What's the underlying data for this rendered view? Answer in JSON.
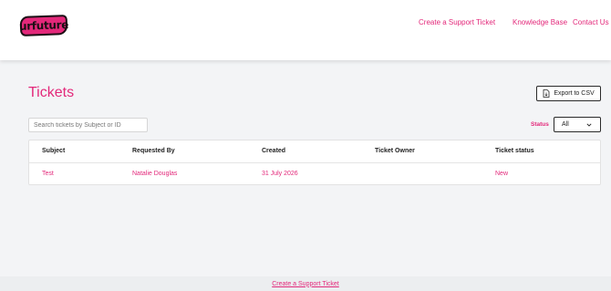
{
  "header": {
    "logo_text": "urfuture",
    "nav": {
      "create_ticket": "Create a Support Ticket",
      "knowledge_base": "Knowledge Base",
      "contact_us": "Contact Us"
    }
  },
  "page": {
    "title": "Tickets",
    "export_label": "Export to CSV",
    "search_placeholder": "Search tickets by Subject or ID",
    "status_label": "Status",
    "status_value": "All"
  },
  "table": {
    "columns": [
      "Subject",
      "Requested By",
      "Created",
      "Ticket Owner",
      "Ticket status"
    ],
    "rows": [
      [
        "Test",
        "Natalie Douglas",
        "31 July 2026",
        "",
        "New"
      ]
    ]
  },
  "footer": {
    "link": "Create a Support Ticket"
  },
  "colors": {
    "accent": "#e3287a",
    "background": "#f3f4f6"
  }
}
